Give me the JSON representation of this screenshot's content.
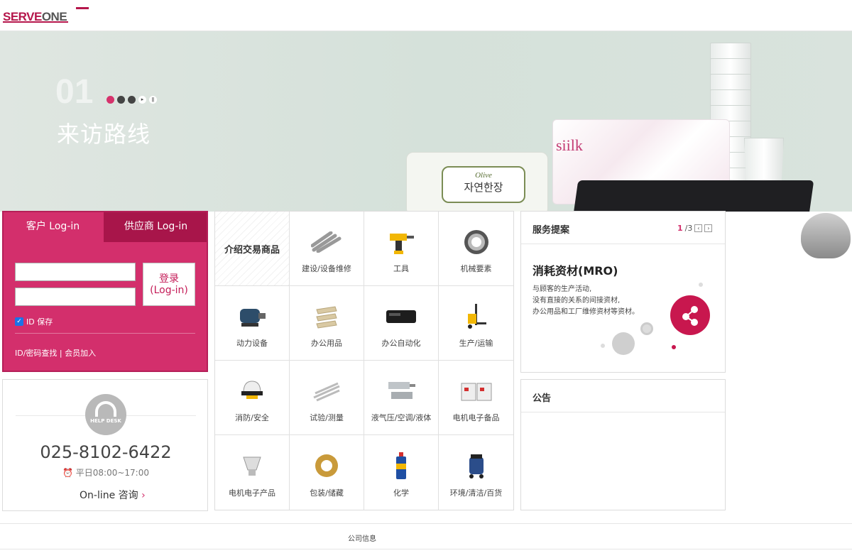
{
  "header": {
    "logo_left": "SERVE",
    "logo_right": "ONE"
  },
  "banner": {
    "slide_number": "01",
    "title": "来访路线",
    "controls": {
      "play": "▸",
      "pause": "ǁ"
    },
    "products": {
      "tissue_brand": "siilk",
      "wipes_brand": "Olive",
      "wipes_label": "자연한장"
    }
  },
  "login": {
    "tab_customer": "客户 Log-in",
    "tab_supplier": "供应商 Log-in",
    "button": "登录\n(Log-in)",
    "button_line1": "登录",
    "button_line2": "(Log-in)",
    "save_id": "ID 保存",
    "links": "ID/密码查找 | 会员加入"
  },
  "helpdesk": {
    "label": "HELP DESK",
    "phone": "025-8102-6422",
    "hours": "平日08:00~17:00",
    "online": "On-line 咨询"
  },
  "products": {
    "title": "介绍交易商品",
    "items": [
      {
        "label": "建设/设备维修"
      },
      {
        "label": "工具"
      },
      {
        "label": "机械要素"
      },
      {
        "label": "动力设备"
      },
      {
        "label": "办公用品"
      },
      {
        "label": "办公自动化"
      },
      {
        "label": "生产/运输"
      },
      {
        "label": "消防/安全"
      },
      {
        "label": "试验/测量"
      },
      {
        "label": "液气压/空调/液体"
      },
      {
        "label": "电机电子备品"
      },
      {
        "label": "电机电子产品"
      },
      {
        "label": "包装/储藏"
      },
      {
        "label": "化学"
      },
      {
        "label": "环境/清洁/百货"
      }
    ]
  },
  "service": {
    "title": "服务提案",
    "page_current": "1",
    "page_total": "/3",
    "heading": "消耗资材(MRO)",
    "desc_line1": "与顾客的生产活动,",
    "desc_line2": "没有直接的关系的间接资材,",
    "desc_line3": "办公用品和工厂维修资材等资材。"
  },
  "notice": {
    "title": "公告"
  },
  "footer": {
    "company_info": "公司信息"
  },
  "colors": {
    "brand": "#d32f6c",
    "brand_dark": "#a8154a"
  }
}
